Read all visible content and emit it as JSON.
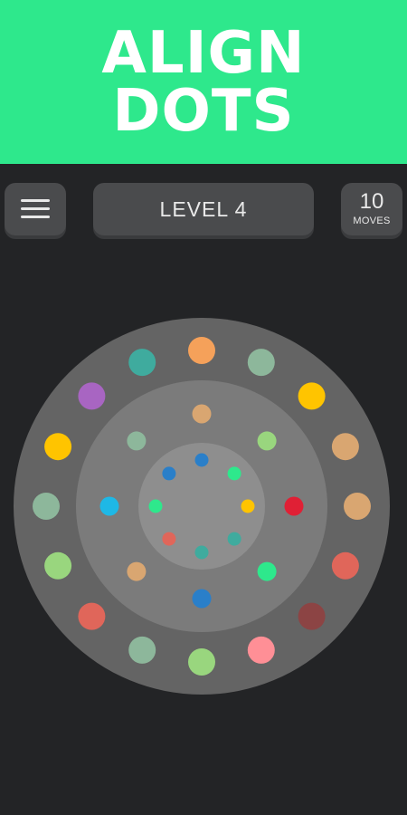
{
  "title": {
    "line1": "ALIGN",
    "line2": "DOTS"
  },
  "toolbar": {
    "menu_icon": "hamburger-menu-icon",
    "level_label": "LEVEL 4",
    "moves_count": "10",
    "moves_label": "MOVES"
  },
  "colors": {
    "banner": "#2ee88c",
    "background": "#232426",
    "button": "#4a4b4d",
    "outer_ring": "#646464",
    "middle_ring": "#7b7b7b",
    "inner_ring": "#8e8e8e"
  },
  "rings": [
    {
      "name": "outer",
      "dots": [
        "#f5a15a",
        "#8db79b",
        "#ffc400",
        "#d9a671",
        "#d9a671",
        "#e0665a",
        "#8c4444",
        "#ff8f96",
        "#99d67e",
        "#8db79b",
        "#e0665a",
        "#99d67e",
        "#8db79b",
        "#ffc400",
        "#a865c2",
        "#3fab9e"
      ]
    },
    {
      "name": "middle",
      "dots": [
        "#d9a671",
        "#99d67e",
        "#e02035",
        "#2ee88c",
        "#2a7fc9",
        "#d9a671",
        "#1eb8e6",
        "#8db79b"
      ]
    },
    {
      "name": "inner",
      "dots": [
        "#2a7fc9",
        "#2ee88c",
        "#ffc400",
        "#3fab9e",
        "#3fab9e",
        "#e0665a",
        "#2ee88c",
        "#2a7fc9"
      ]
    }
  ]
}
